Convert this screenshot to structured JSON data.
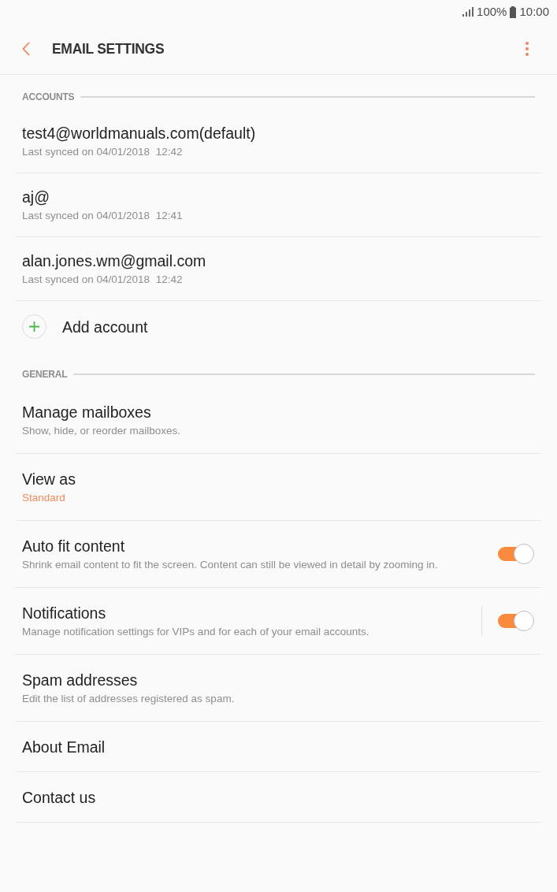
{
  "status_bar": {
    "battery": "100%",
    "time": "10:00"
  },
  "app_bar": {
    "title": "EMAIL SETTINGS"
  },
  "sections": [
    {
      "header": "ACCOUNTS",
      "items": [
        {
          "kind": "account",
          "title": "test4@worldmanuals.com(default)",
          "subtitle": "Last synced on 04/01/2018  12:42"
        },
        {
          "kind": "account",
          "title": "aj@",
          "subtitle": "Last synced on 04/01/2018  12:41"
        },
        {
          "kind": "account",
          "title": "alan.jones.wm@gmail.com",
          "subtitle": "Last synced on 04/01/2018  12:42"
        },
        {
          "kind": "add",
          "title": "Add account"
        }
      ]
    },
    {
      "header": "GENERAL",
      "items": [
        {
          "kind": "link",
          "title": "Manage mailboxes",
          "subtitle": "Show, hide, or reorder mailboxes."
        },
        {
          "kind": "value",
          "title": "View as",
          "value": "Standard"
        },
        {
          "kind": "toggle",
          "title": "Auto fit content",
          "subtitle": "Shrink email content to fit the screen. Content can still be viewed in detail by zooming in.",
          "on": true
        },
        {
          "kind": "split_toggle",
          "title": "Notifications",
          "subtitle": "Manage notification settings for VIPs and for each of your email accounts.",
          "on": true
        },
        {
          "kind": "link",
          "title": "Spam addresses",
          "subtitle": "Edit the list of addresses registered as spam."
        },
        {
          "kind": "link",
          "title": "About Email"
        },
        {
          "kind": "link",
          "title": "Contact us"
        }
      ]
    }
  ]
}
